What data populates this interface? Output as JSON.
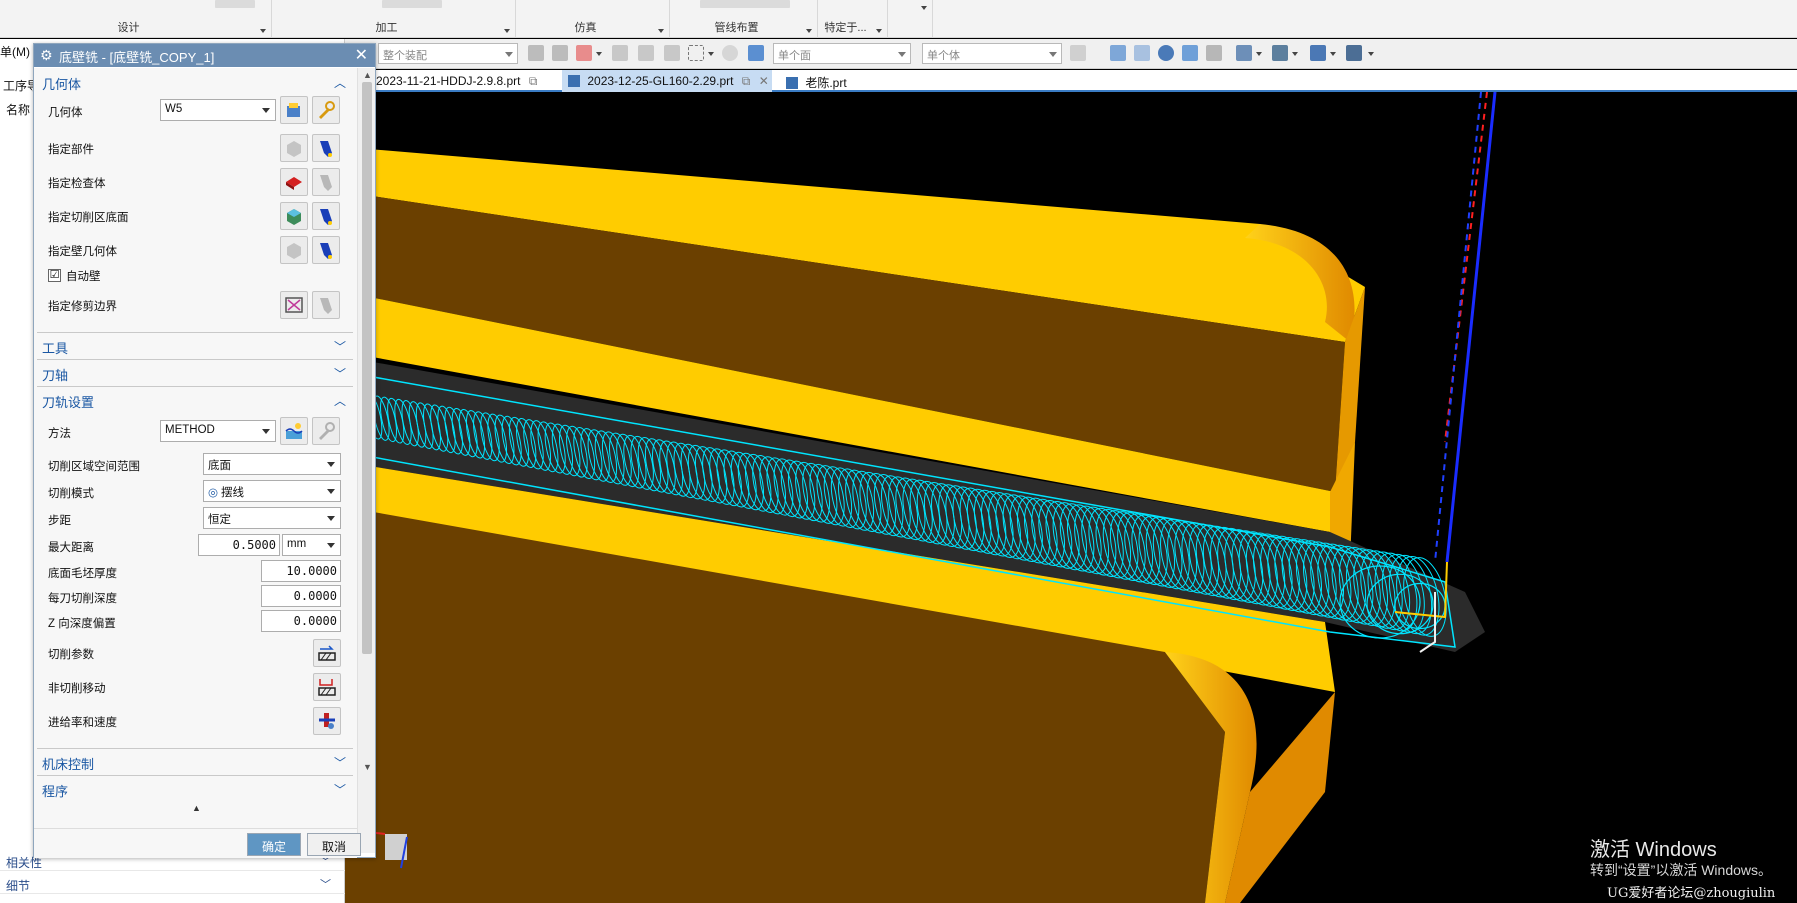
{
  "ribbon": {
    "groups": [
      "设计",
      "加工",
      "仿真",
      "管线布置",
      "特定于..."
    ]
  },
  "filterbar": {
    "assembly_scope": "整个装配",
    "face_rule": "单个面",
    "body_rule": "单个体"
  },
  "tabs": [
    {
      "label": "2023-11-21-HDDJ-2.9.8.prt"
    },
    {
      "label": "2023-12-25-GL160-2.29.prt"
    },
    {
      "label": "老陈.prt"
    }
  ],
  "navigator": {
    "menu_fragment": "单(M)",
    "toolbar_fragment": "工序导",
    "column_name": "名称",
    "bottom_sections": [
      "相关性",
      "细节"
    ]
  },
  "dialog": {
    "title": "底壁铣 - [底壁铣_COPY_1]",
    "geometry": {
      "header": "几何体",
      "geometry_label": "几何体",
      "geometry_value": "W5",
      "specify_part": "指定部件",
      "specify_check": "指定检查体",
      "specify_floor": "指定切削区底面",
      "specify_wall": "指定壁几何体",
      "auto_wall": "自动壁",
      "auto_wall_checked": "☑",
      "specify_trim": "指定修剪边界"
    },
    "tool": {
      "header": "工具"
    },
    "axis": {
      "header": "刀轴"
    },
    "path": {
      "header": "刀轨设置",
      "method_label": "方法",
      "method_value": "METHOD",
      "region_label": "切削区域空间范围",
      "region_value": "底面",
      "pattern_label": "切削模式",
      "pattern_value": "摆线",
      "stepover_label": "步距",
      "stepover_value": "恒定",
      "maxdist_label": "最大距离",
      "maxdist_value": "0.5000",
      "maxdist_unit": "mm",
      "floor_stock_label": "底面毛坯厚度",
      "floor_stock_value": "10.0000",
      "depth_label": "每刀切削深度",
      "depth_value": "0.0000",
      "zoffset_label": "Z 向深度偏置",
      "zoffset_value": "0.0000",
      "cut_params": "切削参数",
      "non_cut": "非切削移动",
      "feeds": "进给率和速度"
    },
    "machine": {
      "header": "机床控制"
    },
    "program": {
      "header": "程序"
    },
    "ok": "确定",
    "cancel": "取消"
  },
  "watermark": {
    "line1": "激活 Windows",
    "line2": "转到“设置”以激活 Windows。",
    "credit": "UG爱好者论坛@zhougiulin"
  },
  "colors": {
    "part_yellow": "#ffcc00",
    "part_brown": "#6b4000",
    "toolpath": "#00e5ff",
    "title_bar": "#6b8db2",
    "section_text": "#1a57a3"
  }
}
